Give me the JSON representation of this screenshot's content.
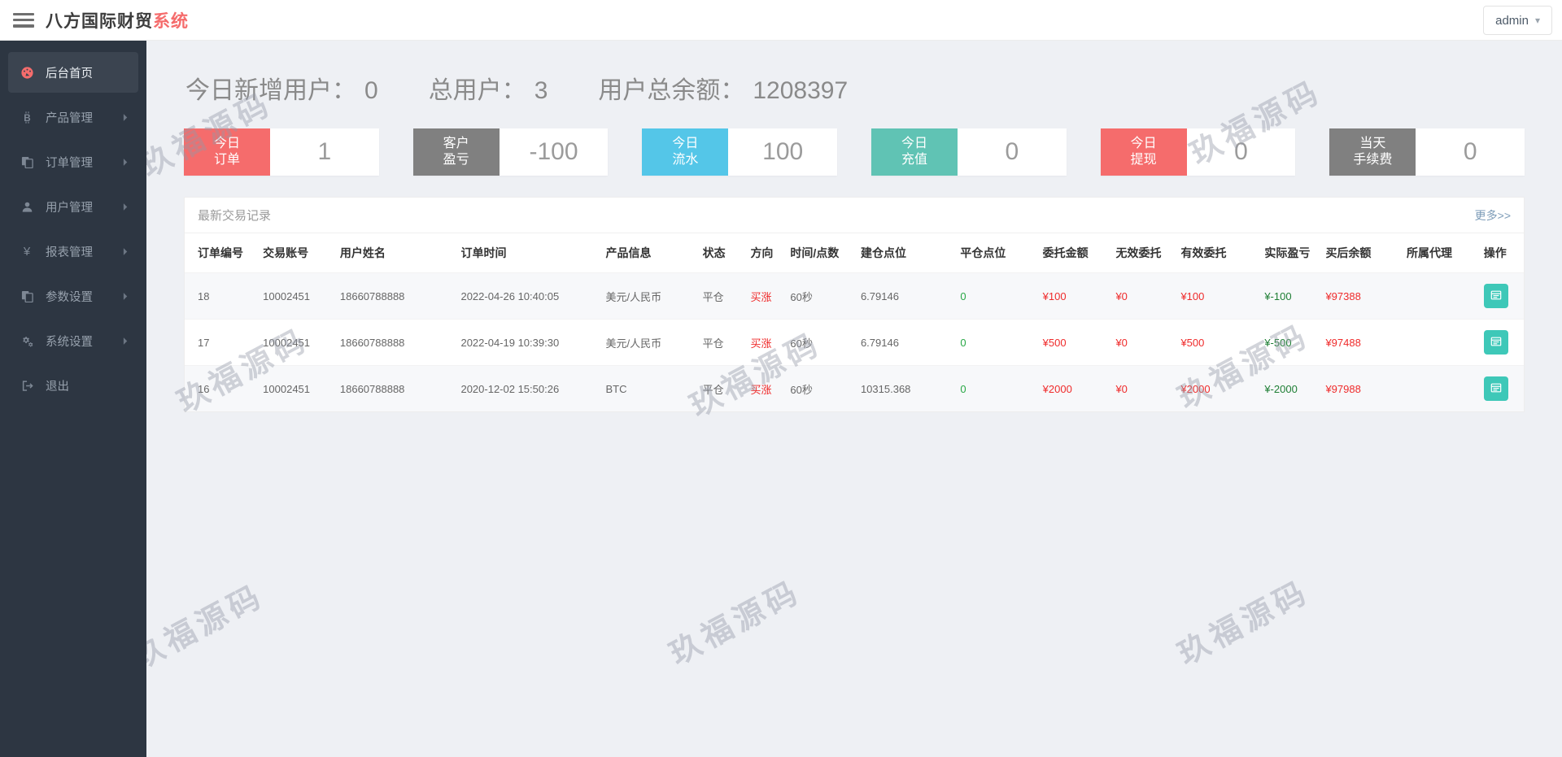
{
  "header": {
    "title_main": "八方国际财贸",
    "title_accent": "系统",
    "user": "admin"
  },
  "sidebar": {
    "items": [
      {
        "icon": "dashboard-icon",
        "label": "后台首页",
        "active": true,
        "has_children": false
      },
      {
        "icon": "bitcoin-icon",
        "label": "产品管理",
        "active": false,
        "has_children": true
      },
      {
        "icon": "orders-icon",
        "label": "订单管理",
        "active": false,
        "has_children": true
      },
      {
        "icon": "user-icon",
        "label": "用户管理",
        "active": false,
        "has_children": true
      },
      {
        "icon": "yen-icon",
        "label": "报表管理",
        "active": false,
        "has_children": true
      },
      {
        "icon": "params-icon",
        "label": "参数设置",
        "active": false,
        "has_children": true
      },
      {
        "icon": "settings-icon",
        "label": "系统设置",
        "active": false,
        "has_children": true
      },
      {
        "icon": "logout-icon",
        "label": "退出",
        "active": false,
        "has_children": false
      }
    ]
  },
  "stats": [
    {
      "label": "今日新增用户：",
      "value": "0"
    },
    {
      "label": "总用户：",
      "value": "3"
    },
    {
      "label": "用户总余额：",
      "value": "1208397"
    }
  ],
  "cards": [
    {
      "label_lines": [
        "今日",
        "订单"
      ],
      "value": "1",
      "color": "#f56c6c"
    },
    {
      "label_lines": [
        "客户",
        "盈亏"
      ],
      "value": "-100",
      "color": "#808080"
    },
    {
      "label_lines": [
        "今日",
        "流水"
      ],
      "value": "100",
      "color": "#54c6e8"
    },
    {
      "label_lines": [
        "今日",
        "充值"
      ],
      "value": "0",
      "color": "#60c3b4"
    },
    {
      "label_lines": [
        "今日",
        "提现"
      ],
      "value": "0",
      "color": "#f56c6c"
    },
    {
      "label_lines": [
        "当天",
        "手续费"
      ],
      "value": "0",
      "color": "#808080"
    }
  ],
  "panel": {
    "title": "最新交易记录",
    "more": "更多>>"
  },
  "table": {
    "headers": [
      "订单编号",
      "交易账号",
      "用户姓名",
      "订单时间",
      "产品信息",
      "状态",
      "方向",
      "时间/点数",
      "建仓点位",
      "平仓点位",
      "委托金额",
      "无效委托",
      "有效委托",
      "实际盈亏",
      "买后余额",
      "所属代理",
      "操作"
    ],
    "rows": [
      [
        "18",
        "10002451",
        "18660788888",
        "2022-04-26 10:40:05",
        "美元/人民币",
        "平仓",
        "买涨",
        "60秒",
        "6.79146",
        "0",
        "¥100",
        "¥0",
        "¥100",
        "¥-100",
        "¥97388",
        ""
      ],
      [
        "17",
        "10002451",
        "18660788888",
        "2022-04-19 10:39:30",
        "美元/人民币",
        "平仓",
        "买涨",
        "60秒",
        "6.79146",
        "0",
        "¥500",
        "¥0",
        "¥500",
        "¥-500",
        "¥97488",
        ""
      ],
      [
        "16",
        "10002451",
        "18660788888",
        "2020-12-02 15:50:26",
        "BTC",
        "平仓",
        "买涨",
        "60秒",
        "10315.368",
        "0",
        "¥2000",
        "¥0",
        "¥2000",
        "¥-2000",
        "¥97988",
        ""
      ]
    ],
    "action_icon": "table-list-icon"
  },
  "watermark": {
    "text": "玖福源码"
  },
  "colors": {
    "accent_red": "#f56c6c",
    "sky_blue": "#54c6e8",
    "teal": "#60c3b4",
    "gray_label": "#808080",
    "cell_red": "#ef2b2b",
    "cell_green": "#28a745",
    "cell_dark_green": "#1e7e34",
    "action_teal": "#3ec8b8",
    "sidebar_bg": "#2d3642",
    "page_bg": "#eef0f4"
  }
}
